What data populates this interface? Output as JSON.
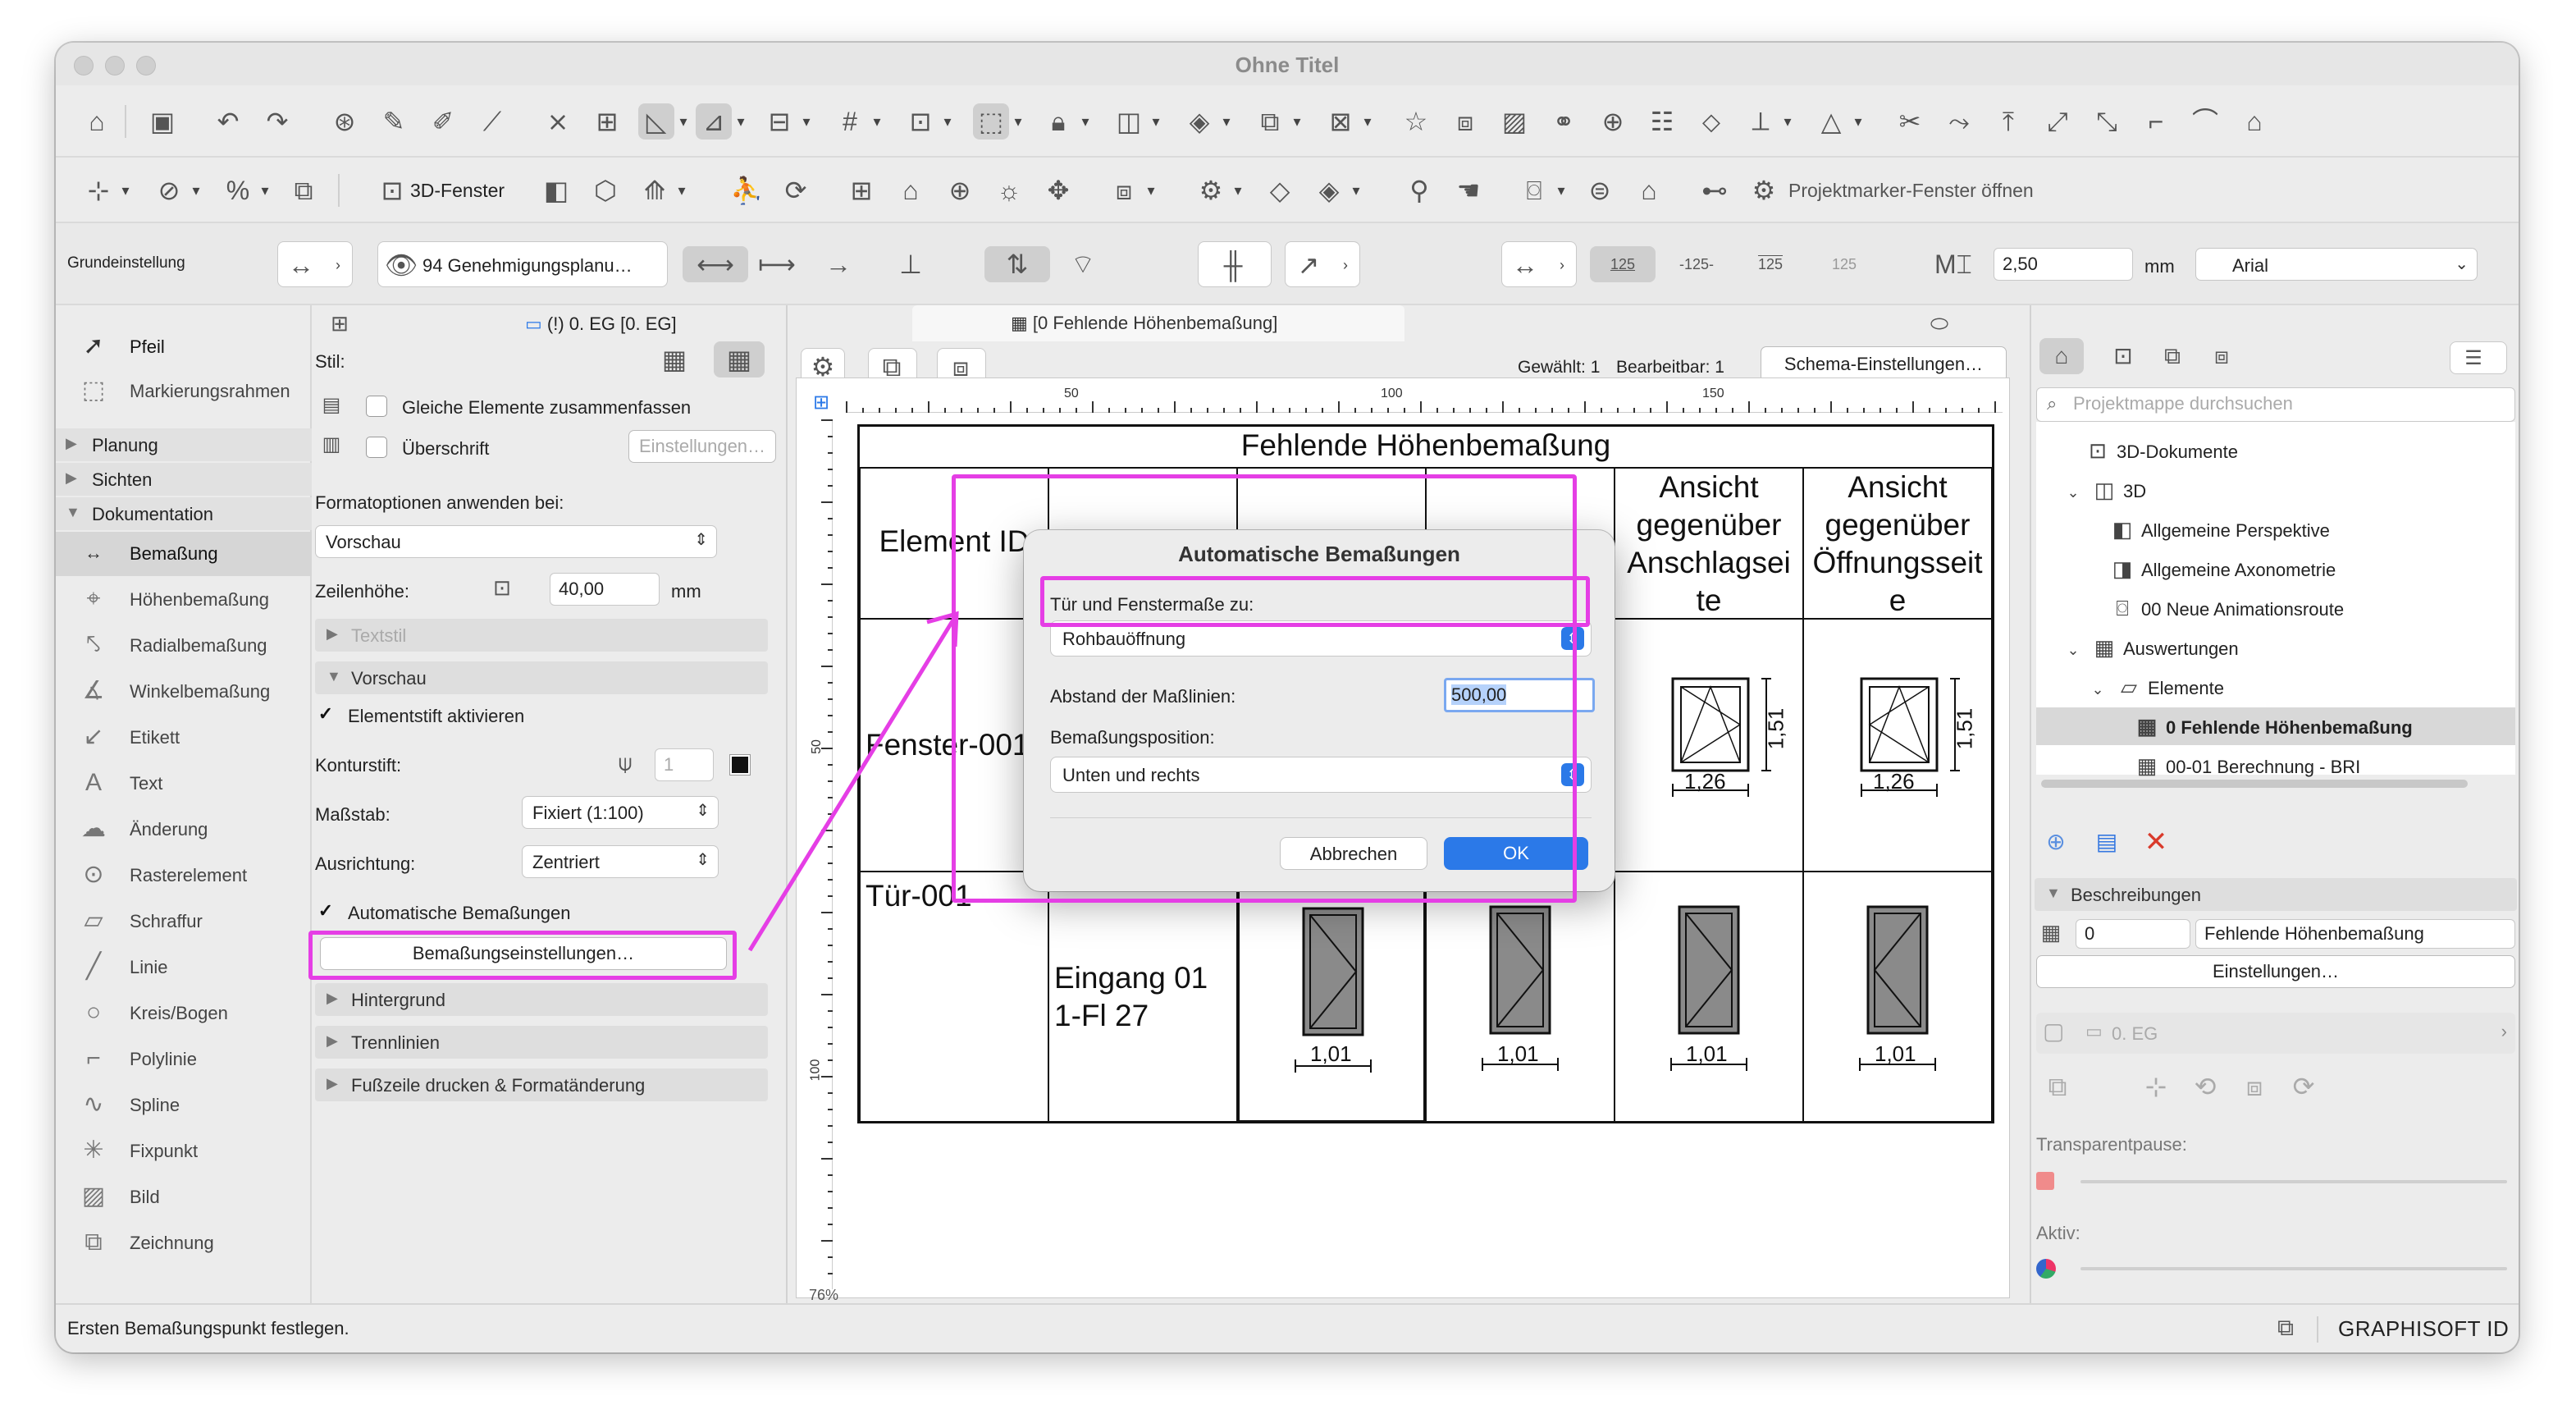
{
  "window": {
    "title": "Ohne Titel"
  },
  "toolbar2": {
    "window3d_label": "3D-Fenster",
    "projectmarker_label": "Projektmarker-Fenster öffnen"
  },
  "infobox": {
    "mode": "Grundeinstellung",
    "layer_combo": "94 Genehmigungsplanu…",
    "text_size": "2,50",
    "unit": "mm",
    "font": "Arial",
    "scale_labels": [
      "125",
      "-125-",
      "125",
      "125"
    ]
  },
  "toolbox": {
    "top_tools": [
      "Pfeil",
      "Markierungsrahmen"
    ],
    "sections": [
      "Planung",
      "Sichten",
      "Dokumentation"
    ],
    "doc_tools": [
      {
        "label": "Bemaßung",
        "icon": "dimension-icon",
        "active": true
      },
      {
        "label": "Höhenbemaßung",
        "icon": "level-dimension-icon"
      },
      {
        "label": "Radialbemaßung",
        "icon": "radial-dimension-icon"
      },
      {
        "label": "Winkelbemaßung",
        "icon": "angle-dimension-icon"
      },
      {
        "label": "Etikett",
        "icon": "label-icon"
      },
      {
        "label": "Text",
        "icon": "text-icon"
      },
      {
        "label": "Änderung",
        "icon": "change-icon"
      },
      {
        "label": "Rasterelement",
        "icon": "grid-element-icon"
      },
      {
        "label": "Schraffur",
        "icon": "fill-icon"
      },
      {
        "label": "Linie",
        "icon": "line-icon"
      },
      {
        "label": "Kreis/Bogen",
        "icon": "arc-icon"
      },
      {
        "label": "Polylinie",
        "icon": "polyline-icon"
      },
      {
        "label": "Spline",
        "icon": "spline-icon"
      },
      {
        "label": "Fixpunkt",
        "icon": "hotspot-icon"
      },
      {
        "label": "Bild",
        "icon": "image-icon"
      },
      {
        "label": "Zeichnung",
        "icon": "drawing-icon"
      }
    ]
  },
  "settings": {
    "tab_label": "(!) 0. EG [0. EG]",
    "stil_label": "Stil:",
    "group_elements": "Gleiche Elemente zusammenfassen",
    "header_label": "Überschrift",
    "einstellungen_btn": "Einstellungen…",
    "format_options_label": "Formatoptionen anwenden bei:",
    "format_options_value": "Vorschau",
    "row_height_label": "Zeilenhöhe:",
    "row_height_value": "40,00",
    "row_height_unit": "mm",
    "textstil": "Textstil",
    "vorschau": "Vorschau",
    "elementstift": "Elementstift aktivieren",
    "konturstift": "Konturstift:",
    "konturstift_value": "1",
    "massstab_label": "Maßstab:",
    "massstab_value": "Fixiert (1:100)",
    "ausrichtung_label": "Ausrichtung:",
    "ausrichtung_value": "Zentriert",
    "auto_dims": "Automatische Bemaßungen",
    "dim_settings_btn": "Bemaßungseinstellungen…",
    "hintergrund": "Hintergrund",
    "trennlinien": "Trennlinien",
    "fusszeile": "Fußzeile drucken & Formatänderung"
  },
  "center": {
    "tab_label": "[0 Fehlende Höhenbemaßung]",
    "selected_info": "Gewählt: 1",
    "editable_info": "Bearbeitbar: 1",
    "schema_btn": "Schema-Einstellungen…",
    "ruler_h": [
      "50",
      "100",
      "150"
    ],
    "ruler_v": [
      "50",
      "100"
    ],
    "zoom": "76%"
  },
  "schedule": {
    "title": "Fehlende Höhenbemaßung",
    "col_element_id": "Element ID",
    "col_anschlag": [
      "Ansicht",
      "gegenüber",
      "Anschlagsei",
      "te"
    ],
    "col_oeffnung": [
      "Ansicht",
      "gegenüber",
      "Öffnungsseit",
      "e"
    ],
    "row1_id": "Fenster-001",
    "row2_id": "Tür-001",
    "row2_name": [
      "Eingang 01",
      "1-Fl 27"
    ],
    "win_w": "1,26",
    "win_h": "1,51",
    "door_w": "1,01"
  },
  "dialog": {
    "title": "Automatische Bemaßungen",
    "label_measure": "Tür und Fenstermaße zu:",
    "measure_value": "Rohbauöffnung",
    "label_distance": "Abstand der Maßlinien:",
    "distance_value": "500,00",
    "label_position": "Bemaßungsposition:",
    "position_value": "Unten und rechts",
    "cancel": "Abbrechen",
    "ok": "OK"
  },
  "navigator": {
    "search_placeholder": "Projektmappe durchsuchen",
    "items": [
      {
        "label": "3D-Dokumente",
        "icon": "folder-3d-docs-icon"
      },
      {
        "label": "3D",
        "icon": "cube-icon"
      },
      {
        "label": "Allgemeine Perspektive",
        "icon": "perspective-icon"
      },
      {
        "label": "Allgemeine Axonometrie",
        "icon": "axonometry-icon"
      },
      {
        "label": "00 Neue Animationsroute",
        "icon": "camera-path-icon"
      },
      {
        "label": "Auswertungen",
        "icon": "table-icon"
      },
      {
        "label": "Elemente",
        "icon": "elements-icon"
      },
      {
        "label": "0 Fehlende Höhenbemaßung",
        "icon": "table-icon"
      },
      {
        "label": "00-01 Berechnung - BRI",
        "icon": "table-icon"
      }
    ],
    "beschreibungen": "Beschreibungen",
    "id_value": "0",
    "name_value": "Fehlende Höhenbemaßung",
    "einstellungen": "Einstellungen…",
    "story": "0. EG",
    "transparentpause": "Transparentpause:",
    "aktiv": "Aktiv:"
  },
  "status": {
    "message": "Ersten Bemaßungspunkt festlegen.",
    "brand": "GRAPHISOFT ID"
  },
  "colors": {
    "highlight": "#e53ee5",
    "accent": "#2b79e8"
  }
}
